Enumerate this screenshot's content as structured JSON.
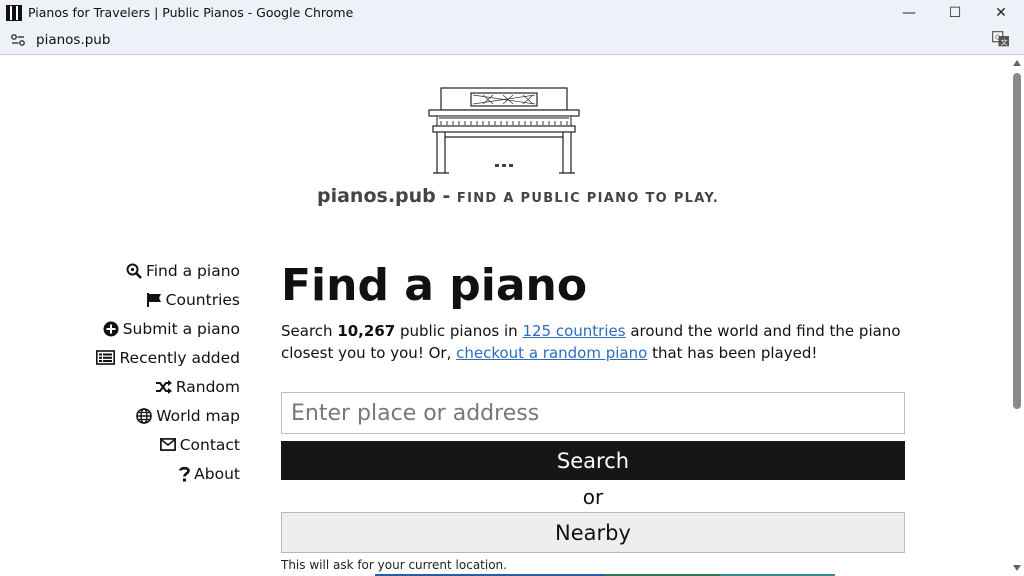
{
  "window": {
    "title": "Pianos for Travelers | Public Pianos - Google Chrome",
    "controls": {
      "minimize": "—",
      "maximize": "☐",
      "close": "✕"
    }
  },
  "browser": {
    "url": "pianos.pub",
    "icons": [
      "site-info-icon",
      "translate-icon"
    ]
  },
  "header": {
    "site_name": "pianos.pub",
    "separator": " - ",
    "tagline": "FIND A PUBLIC PIANO TO PLAY."
  },
  "nav": {
    "items": [
      {
        "label": "Find a piano",
        "icon": "search-icon"
      },
      {
        "label": "Countries",
        "icon": "flag-icon"
      },
      {
        "label": "Submit a piano",
        "icon": "plus-circle-icon"
      },
      {
        "label": "Recently added",
        "icon": "list-icon"
      },
      {
        "label": "Random",
        "icon": "shuffle-icon"
      },
      {
        "label": "World map",
        "icon": "globe-icon"
      },
      {
        "label": "Contact",
        "icon": "envelope-icon"
      },
      {
        "label": "About",
        "icon": "question-icon"
      }
    ]
  },
  "main": {
    "heading": "Find a piano",
    "desc": {
      "part1": "Search ",
      "count": "10,267",
      "part2": " public pianos in ",
      "countries_link": "125 countries",
      "part3": " around the world and find the piano closest you to you! Or, ",
      "random_link": "checkout a random piano",
      "part4": " that has been played!"
    },
    "search_placeholder": "Enter place or address",
    "search_value": "",
    "search_button": "Search",
    "or_text": "or",
    "nearby_button": "Nearby",
    "hint": "This will ask for your current location."
  },
  "colors": {
    "link": "#2a6ebb",
    "button_dark": "#161616",
    "button_light": "#eeeeee"
  }
}
